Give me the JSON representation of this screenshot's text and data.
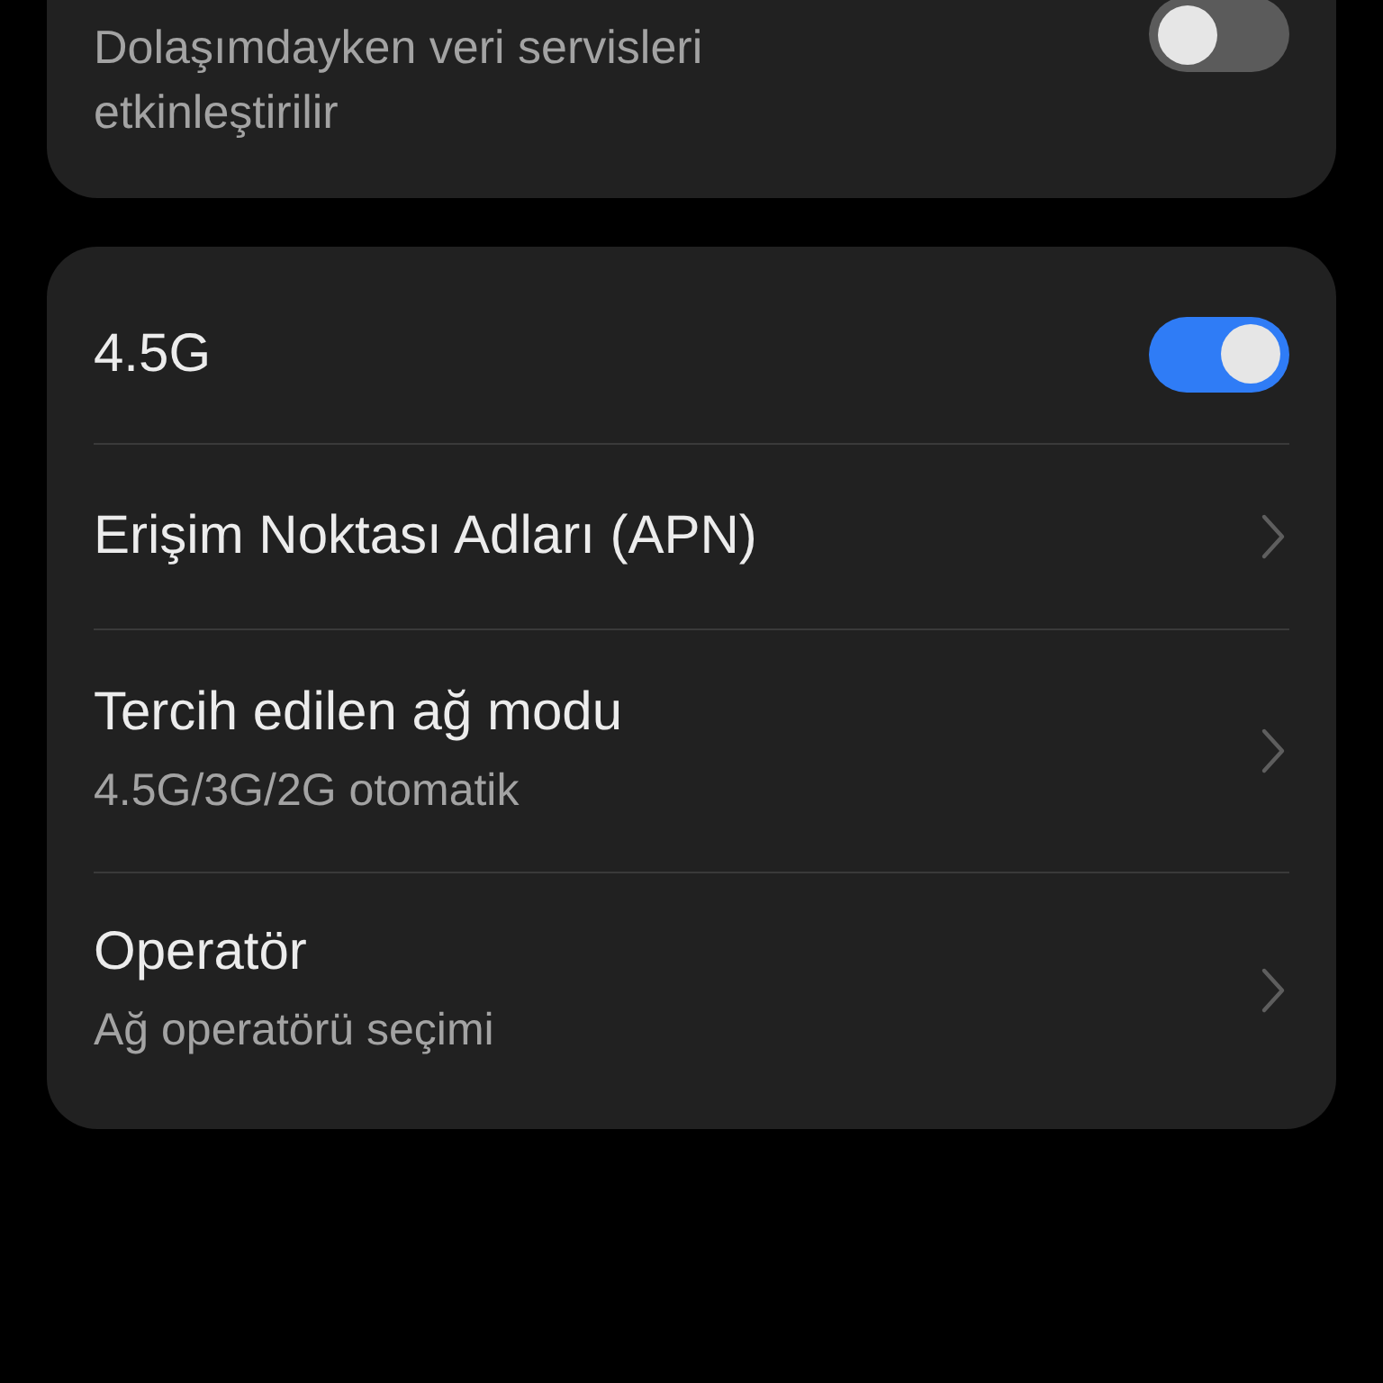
{
  "roaming_card": {
    "description": "Dolaşımdayken veri servisleri etkinleştirilir",
    "on": false
  },
  "settings": [
    {
      "kind": "toggle",
      "title": "4.5G",
      "on": true
    },
    {
      "kind": "link",
      "title": "Erişim Noktası Adları (APN)"
    },
    {
      "kind": "link",
      "title": "Tercih edilen ağ modu",
      "subtitle": "4.5G/3G/2G otomatik"
    },
    {
      "kind": "link",
      "title": "Operatör",
      "subtitle": "Ağ operatörü seçimi"
    }
  ]
}
